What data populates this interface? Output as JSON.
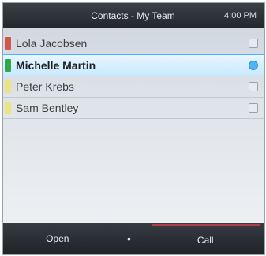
{
  "header": {
    "title": "Contacts - My Team",
    "time": "4:00 PM"
  },
  "contacts": [
    {
      "name": "Lola Jacobsen",
      "presence_color": "#d0574a"
    },
    {
      "name": "Michelle Martin",
      "presence_color": "#2fa84a"
    },
    {
      "name": "Peter Krebs",
      "presence_color": "#ece57d"
    },
    {
      "name": "Sam Bentley",
      "presence_color": "#ece57d"
    }
  ],
  "softkeys": {
    "open": "Open",
    "center": "•",
    "call": "Call"
  }
}
